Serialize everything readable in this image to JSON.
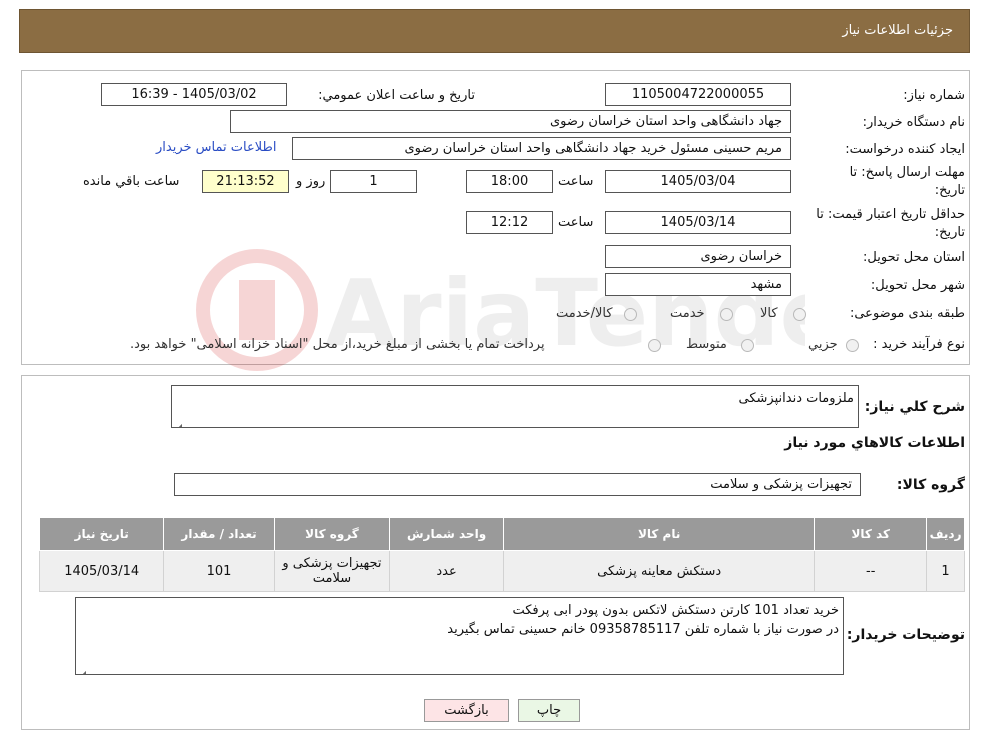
{
  "header": {
    "title": "جزئیات اطلاعات نیاز"
  },
  "form": {
    "need_number_label": "شماره نیاز:",
    "need_number": "1105004722000055",
    "announce_label": "تاریخ و ساعت اعلان عمومي:",
    "announce_value": "1405/03/02 - 16:39",
    "buyer_org_label": "نام دستگاه خريدار:",
    "buyer_org": "جهاد دانشگاهی واحد استان خراسان رضوی",
    "creator_label": "ايجاد کننده درخواست:",
    "creator": "مریم حسینی مسئول خرید جهاد دانشگاهی واحد استان خراسان رضوی",
    "contact_link": "اطلاعات تماس خريدار",
    "deadline_label_1": "مهلت ارسال پاسخ: تا",
    "deadline_label_2": "تاريخ:",
    "deadline_date": "1405/03/04",
    "time_label": "ساعت",
    "deadline_time": "18:00",
    "days_value": "1",
    "days_label": "روز و",
    "remaining_time": "21:13:52",
    "remaining_label": "ساعت باقي مانده",
    "validity_label_1": "حداقل تاريخ اعتبار قيمت: تا",
    "validity_label_2": "تاريخ:",
    "validity_date": "1405/03/14",
    "validity_time": "12:12",
    "province_label": "استان محل تحويل:",
    "province": "خراسان رضوی",
    "city_label": "شهر محل تحويل:",
    "city": "مشهد",
    "category_label": "طبقه بندی موضوعی:",
    "category_options": [
      "کالا",
      "خدمت",
      "کالا/خدمت"
    ],
    "process_label": "نوع فرآيند خريد :",
    "process_options": [
      "جزيي",
      "متوسط"
    ],
    "process_note": "پرداخت تمام يا بخشی از مبلغ خريد،از محل \"اسناد خزانه اسلامی\" خواهد بود."
  },
  "details": {
    "summary_label": "شرح کلي نياز:",
    "summary": "ملزومات دندانپزشکی",
    "goods_info_title": "اطلاعات کالاهاي مورد نياز",
    "group_label": "گروه کالا:",
    "group_value": "تجهیزات پزشکی و سلامت"
  },
  "table": {
    "headers": [
      "رديف",
      "کد کالا",
      "نام کالا",
      "واحد شمارش",
      "گروه کالا",
      "تعداد / مقدار",
      "تاريخ نياز"
    ],
    "rows": [
      [
        "1",
        "--",
        "دستکش معاینه پزشکی",
        "عدد",
        "تجهیزات پزشکی و سلامت",
        "101",
        "1405/03/14"
      ]
    ]
  },
  "buyer_notes": {
    "label": "توضيحات خريدار:",
    "line1": "خرید تعداد 101 کارتن دستکش لاتکس بدون پودر ابی پرفکت",
    "line2": "در صورت نیاز با شماره تلفن 09358785117 خانم حسینی تماس بگیرید"
  },
  "buttons": {
    "print": "چاپ",
    "back": "بازگشت"
  },
  "colors": {
    "header_bg": "#8b6d43",
    "link": "#2a4dc4",
    "back_button": "#fde4e6",
    "print_button": "#eaf7e5"
  }
}
